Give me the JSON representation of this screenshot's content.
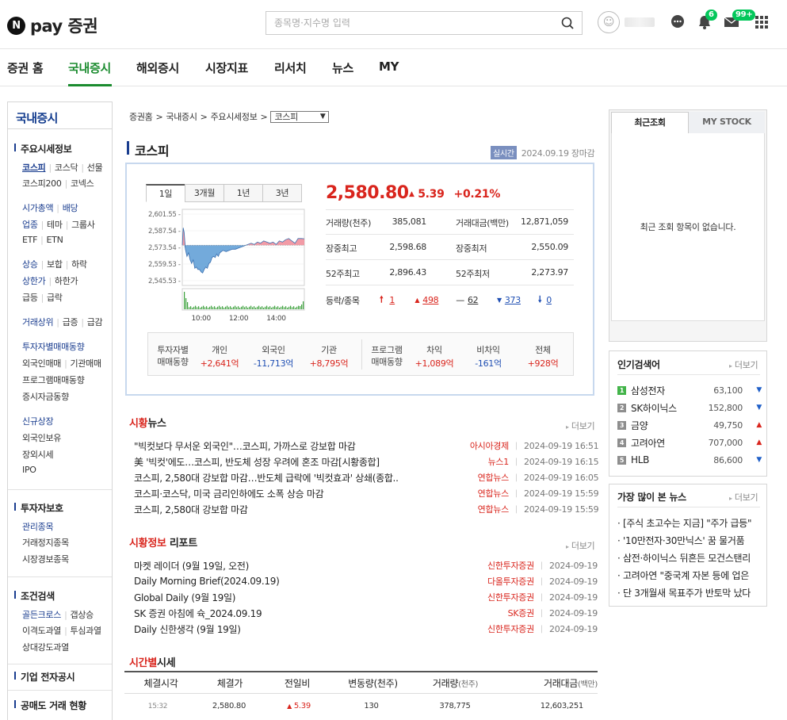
{
  "header": {
    "logo_text": "pay 증권",
    "logo_mark": "N",
    "search_placeholder": "종목명·지수명 입력",
    "alarm_count": "6",
    "mail_count": "99+"
  },
  "nav": [
    "증권 홈",
    "국내증시",
    "해외증시",
    "시장지표",
    "리서치",
    "뉴스",
    "MY"
  ],
  "sidebar": {
    "title": "국내증시",
    "sections": [
      "주요시세정보",
      "투자자보호",
      "조건검색",
      "기업 전자공시",
      "공매도 거래 현황"
    ],
    "links": {
      "l1": [
        "코스피",
        "코스닥",
        "선물"
      ],
      "l2": [
        "코스피200",
        "코넥스"
      ],
      "l3": [
        "시가총액",
        "배당"
      ],
      "l4": [
        "업종",
        "테마",
        "그룹사"
      ],
      "l5": [
        "ETF",
        "ETN"
      ],
      "l6": [
        "상승",
        "보합",
        "하락"
      ],
      "l7": [
        "상한가",
        "하한가"
      ],
      "l8": [
        "급등",
        "급락"
      ],
      "l9": [
        "거래상위",
        "급증",
        "급감"
      ],
      "l10": "투자자별매매동향",
      "l11": [
        "외국인매매",
        "기관매매"
      ],
      "l12": "프로그램매매동향",
      "l13": "증시자금동향",
      "l14": "신규상장",
      "l15": "외국인보유",
      "l16": "장외시세",
      "l17": "IPO",
      "l18": "관리종목",
      "l19": "거래정지종목",
      "l20": "시장경보종목",
      "l21": [
        "골든크로스",
        "갭상승"
      ],
      "l22": [
        "이격도과열",
        "투심과열"
      ],
      "l23": "상대강도과열"
    }
  },
  "breadcrumb": [
    "증권홈",
    "국내증시",
    "주요시세정보"
  ],
  "breadcrumb_select": "코스피",
  "index_title": "코스피",
  "realtime": {
    "tag": "실시간",
    "time": "2024.09.19 장마감"
  },
  "chart_tabs": [
    "1일",
    "3개월",
    "1년",
    "3년"
  ],
  "chart_data": {
    "type": "line",
    "yticks": [
      "2,601.55",
      "2,587.54",
      "2,573.54",
      "2,559.53",
      "2,545.53"
    ],
    "ylim": [
      2545.53,
      2601.55
    ],
    "baseline": 2575.41,
    "xticks": [
      "10:00",
      "12:00",
      "14:00"
    ],
    "x_minutes": [
      0,
      3,
      6,
      10,
      15,
      20,
      25,
      30,
      35,
      40,
      45,
      50,
      55,
      60,
      65,
      70,
      75,
      80,
      85,
      90,
      95,
      100,
      105,
      110,
      115,
      120,
      130,
      140,
      150,
      160,
      170,
      180,
      190,
      200,
      210,
      220,
      230,
      240,
      250,
      260,
      270,
      280,
      290,
      300,
      310,
      320,
      330,
      340,
      350,
      360,
      370,
      380,
      390
    ],
    "values": [
      2575.4,
      2590,
      2586,
      2572,
      2566,
      2569,
      2563,
      2560,
      2563,
      2556,
      2557,
      2555,
      2555,
      2553,
      2552,
      2555,
      2557,
      2556,
      2560,
      2561,
      2565,
      2566,
      2565,
      2568,
      2566,
      2569,
      2571,
      2570,
      2571,
      2572,
      2572,
      2573,
      2574,
      2575,
      2576,
      2577,
      2576,
      2578,
      2577,
      2579,
      2578,
      2577,
      2578,
      2576,
      2579,
      2578,
      2580,
      2581,
      2579,
      2577,
      2581,
      2581,
      2580.8
    ]
  },
  "quote": {
    "price": "2,580.80",
    "change": "5.39",
    "rate": "+0.21%",
    "rows": [
      {
        "k1": "거래량(천주)",
        "v1": "385,081",
        "k2": "거래대금(백만)",
        "v2": "12,871,059"
      },
      {
        "k1": "장중최고",
        "v1": "2,598.68",
        "k2": "장중최저",
        "v2": "2,550.09"
      },
      {
        "k1": "52주최고",
        "v1": "2,896.43",
        "k2": "52주최저",
        "v2": "2,273.97"
      }
    ],
    "updown_label": "등락/종목",
    "upper": "1",
    "up": "498",
    "flat": "62",
    "down": "373",
    "lower": "0"
  },
  "investors": {
    "label1": "투자자별",
    "label2": "매매동향",
    "cols": [
      {
        "h": "개인",
        "v": "+2,641억"
      },
      {
        "h": "외국인",
        "v": "-11,713억"
      },
      {
        "h": "기관",
        "v": "+8,795억"
      }
    ],
    "plabel1": "프로그램",
    "plabel2": "매매동향",
    "pcols": [
      {
        "h": "차익",
        "v": "+1,089억"
      },
      {
        "h": "비차익",
        "v": "-161억"
      },
      {
        "h": "전체",
        "v": "+928억"
      }
    ]
  },
  "news": {
    "h_red": "시황",
    "h_rest": "뉴스",
    "more": "더보기",
    "items": [
      {
        "t": "\"빅컷보다 무서운 외국인\"…코스피, 가까스로 강보합 마감",
        "s": "아시아경제",
        "d": "2024-09-19 16:51"
      },
      {
        "t": "美 '빅컷'에도…코스피, 반도체 성장 우려에 혼조 마감[시황종합]",
        "s": "뉴스1",
        "d": "2024-09-19 16:15"
      },
      {
        "t": "코스피, 2,580대 강보합 마감…반도체 급락에 '빅컷효과' 상쇄(종합..",
        "s": "연합뉴스",
        "d": "2024-09-19 16:05"
      },
      {
        "t": "코스피·코스닥, 미국 금리인하에도 소폭 상승 마감",
        "s": "연합뉴스",
        "d": "2024-09-19 15:59"
      },
      {
        "t": "코스피, 2,580대 강보합 마감",
        "s": "연합뉴스",
        "d": "2024-09-19 15:59"
      }
    ]
  },
  "report": {
    "h_red": "시황정보",
    "h_rest": "리포트",
    "more": "더보기",
    "items": [
      {
        "t": "마켓 레이더 (9월 19일, 오전)",
        "s": "신한투자증권",
        "d": "2024-09-19"
      },
      {
        "t": "Daily Morning Brief(2024.09.19)",
        "s": "다올투자증권",
        "d": "2024-09-19"
      },
      {
        "t": "Global Daily (9월 19일)",
        "s": "신한투자증권",
        "d": "2024-09-19"
      },
      {
        "t": "SK 증권 아침에 슉_2024.09.19",
        "s": "SK증권",
        "d": "2024-09-19"
      },
      {
        "t": "Daily 신한생각 (9월 19일)",
        "s": "신한투자증권",
        "d": "2024-09-19"
      }
    ]
  },
  "time_table": {
    "h_red": "시간별",
    "h_rest": "시세",
    "headers": [
      "체결시각",
      "체결가",
      "전일비",
      "변동량(천주)",
      "거래량",
      "(천주)",
      "거래대금",
      "(백만)"
    ],
    "row": [
      "15:32",
      "2,580.80",
      "5.39",
      "130",
      "378,775",
      "12,603,251"
    ]
  },
  "recent": {
    "tab1": "최근조회",
    "tab2": "MY STOCK",
    "empty": "최근 조회 항목이 없습니다."
  },
  "popular": {
    "title": "인기검색어",
    "more": "더보기",
    "items": [
      {
        "r": "1",
        "n": "삼성전자",
        "v": "63,100",
        "dir": "down"
      },
      {
        "r": "2",
        "n": "SK하이닉스",
        "v": "152,800",
        "dir": "down"
      },
      {
        "r": "3",
        "n": "금양",
        "v": "49,750",
        "dir": "up"
      },
      {
        "r": "4",
        "n": "고려아연",
        "v": "707,000",
        "dir": "up"
      },
      {
        "r": "5",
        "n": "HLB",
        "v": "86,600",
        "dir": "down"
      }
    ]
  },
  "mostviewed": {
    "title": "가장 많이 본 뉴스",
    "more": "더보기",
    "items": [
      "[주식 초고수는 지금] \"주가 급등\"",
      "'10만전자·30만닉스' 꿈 물거품",
      "삼전·하이닉스 뒤흔든 모건스탠리",
      "고려아연 \"중국계 자본 등에 업은",
      "단 3개월새 목표주가 반토막 났다"
    ]
  }
}
